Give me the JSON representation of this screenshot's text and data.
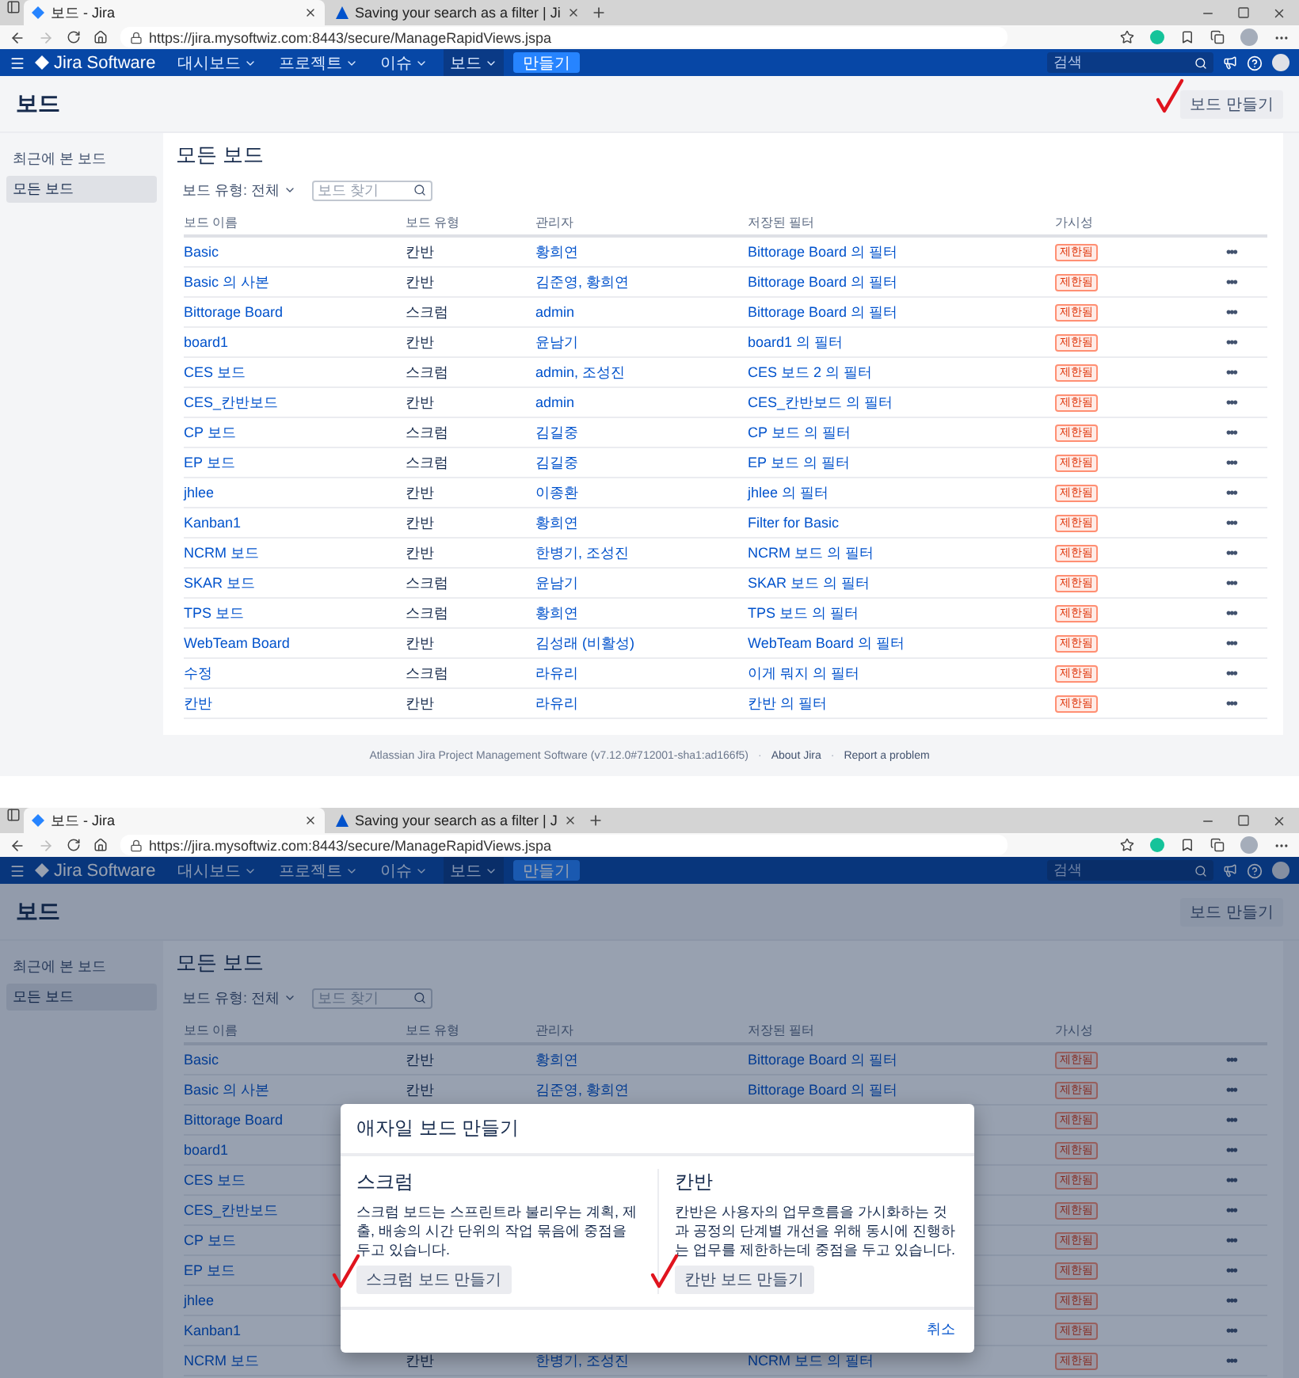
{
  "screens": [
    {
      "browser": {
        "tabs": [
          {
            "title": "보드 - Jira",
            "kind": "jira",
            "selected": true
          },
          {
            "title": "Saving your search as a filter | Ji",
            "kind": "atlassian",
            "selected": false
          }
        ],
        "url": "https://jira.mysoftwiz.com:8443/secure/ManageRapidViews.jspa"
      },
      "nav": {
        "logo": "Jira Software",
        "menus": [
          {
            "label": "대시보드",
            "selected": false
          },
          {
            "label": "프로젝트",
            "selected": false
          },
          {
            "label": "이슈",
            "selected": false
          },
          {
            "label": "보드",
            "selected": true
          }
        ],
        "create": "만들기",
        "search": {
          "placeholder": "검색"
        }
      },
      "header": {
        "title": "보드",
        "button": {
          "label": "보드 만들기",
          "annotated": true
        }
      },
      "sidebar": [
        {
          "label": "최근에 본 보드",
          "selected": false
        },
        {
          "label": "모든 보드",
          "selected": true
        }
      ],
      "content": {
        "title": "모든 보드",
        "filter": "보드 유형: 전체",
        "search": {
          "placeholder": "보드 찾기"
        }
      },
      "table": {
        "columns": [
          "보드 이름",
          "보드 유형",
          "관리자",
          "저장된 필터",
          "가시성"
        ],
        "rows": [
          {
            "name": "Basic",
            "type": "칸반",
            "admin": "황희연",
            "filter": "Bittorage Board 의 필터",
            "visibility": "제한됨",
            "more": "•••"
          },
          {
            "name": "Basic 의 사본",
            "type": "칸반",
            "admin": "김준영, 황희연",
            "filter": "Bittorage Board 의 필터",
            "visibility": "제한됨",
            "more": "•••"
          },
          {
            "name": "Bittorage Board",
            "type": "스크럼",
            "admin": "admin",
            "filter": "Bittorage Board 의 필터",
            "visibility": "제한됨",
            "more": "•••"
          },
          {
            "name": "board1",
            "type": "칸반",
            "admin": "윤남기",
            "filter": "board1 의 필터",
            "visibility": "제한됨",
            "more": "•••"
          },
          {
            "name": "CES 보드",
            "type": "스크럼",
            "admin": "admin, 조성진",
            "filter": "CES 보드 2 의 필터",
            "visibility": "제한됨",
            "more": "•••"
          },
          {
            "name": "CES_칸반보드",
            "type": "칸반",
            "admin": "admin",
            "filter": "CES_칸반보드 의 필터",
            "visibility": "제한됨",
            "more": "•••"
          },
          {
            "name": "CP 보드",
            "type": "스크럼",
            "admin": "김길중",
            "filter": "CP 보드 의 필터",
            "visibility": "제한됨",
            "more": "•••"
          },
          {
            "name": "EP 보드",
            "type": "스크럼",
            "admin": "김길중",
            "filter": "EP 보드 의 필터",
            "visibility": "제한됨",
            "more": "•••"
          },
          {
            "name": "jhlee",
            "type": "칸반",
            "admin": "이종환",
            "filter": "jhlee 의 필터",
            "visibility": "제한됨",
            "more": "•••"
          },
          {
            "name": "Kanban1",
            "type": "칸반",
            "admin": "황희연",
            "filter": "Filter for Basic",
            "visibility": "제한됨",
            "more": "•••"
          },
          {
            "name": "NCRM 보드",
            "type": "칸반",
            "admin": "한병기, 조성진",
            "filter": "NCRM 보드 의 필터",
            "visibility": "제한됨",
            "more": "•••"
          },
          {
            "name": "SKAR 보드",
            "type": "스크럼",
            "admin": "윤남기",
            "filter": "SKAR 보드 의 필터",
            "visibility": "제한됨",
            "more": "•••"
          },
          {
            "name": "TPS 보드",
            "type": "스크럼",
            "admin": "황희연",
            "filter": "TPS 보드 의 필터",
            "visibility": "제한됨",
            "more": "•••"
          },
          {
            "name": "WebTeam Board",
            "type": "칸반",
            "admin": "김성래 (비활성)",
            "filter": "WebTeam Board 의 필터",
            "visibility": "제한됨",
            "more": "•••"
          },
          {
            "name": "수정",
            "type": "스크럼",
            "admin": "라유리",
            "filter": "이게 뭐지 의 필터",
            "visibility": "제한됨",
            "more": "•••"
          },
          {
            "name": "칸반",
            "type": "칸반",
            "admin": "라유리",
            "filter": "칸반 의 필터",
            "visibility": "제한됨",
            "more": "•••"
          }
        ]
      },
      "footer": [
        {
          "text": "Atlassian Jira Project Management Software (v7.12.0#712001-sha1:ad166f5)",
          "kind": "text"
        },
        {
          "text": "·",
          "kind": "separator"
        },
        {
          "text": "About Jira",
          "kind": "link"
        },
        {
          "text": "·",
          "kind": "separator"
        },
        {
          "text": "Report a problem",
          "kind": "link"
        }
      ]
    },
    {
      "browser": {
        "tabs": [
          {
            "title": "보드 - Jira",
            "kind": "jira",
            "selected": true
          },
          {
            "title": "Saving your search as a filter | J",
            "kind": "atlassian",
            "selected": false
          }
        ],
        "url": "https://jira.mysoftwiz.com:8443/secure/ManageRapidViews.jspa"
      },
      "nav": {
        "logo": "Jira Software",
        "menus": [
          {
            "label": "대시보드",
            "selected": false
          },
          {
            "label": "프로젝트",
            "selected": false
          },
          {
            "label": "이슈",
            "selected": false
          },
          {
            "label": "보드",
            "selected": true
          }
        ],
        "create": "만들기",
        "search": {
          "placeholder": "검색"
        }
      },
      "header": {
        "title": "보드",
        "button": {
          "label": "보드 만들기"
        }
      },
      "sidebar": [
        {
          "label": "최근에 본 보드",
          "selected": false
        },
        {
          "label": "모든 보드",
          "selected": true
        }
      ],
      "content": {
        "title": "모든 보드",
        "filter": "보드 유형: 전체",
        "search": {
          "placeholder": "보드 찾기"
        }
      },
      "table": {
        "columns": [
          "보드 이름",
          "보드 유형",
          "관리자",
          "저장된 필터",
          "가시성"
        ],
        "rows": [
          {
            "name": "Basic",
            "type": "칸반",
            "admin": "황희연",
            "filter": "Bittorage Board 의 필터",
            "visibility": "제한됨",
            "more": "•••"
          },
          {
            "name": "Basic 의 사본",
            "type": "칸반",
            "admin": "김준영, 황희연",
            "filter": "Bittorage Board 의 필터",
            "visibility": "제한됨",
            "more": "•••"
          },
          {
            "name": "Bittorage Board",
            "visibility": "제한됨",
            "more": "•••"
          },
          {
            "name": "board1",
            "visibility": "제한됨",
            "more": "•••"
          },
          {
            "name": "CES 보드",
            "visibility": "제한됨",
            "more": "•••"
          },
          {
            "name": "CES_칸반보드",
            "visibility": "제한됨",
            "more": "•••"
          },
          {
            "name": "CP 보드",
            "visibility": "제한됨",
            "more": "•••"
          },
          {
            "name": "EP 보드",
            "visibility": "제한됨",
            "more": "•••"
          },
          {
            "name": "jhlee",
            "visibility": "제한됨",
            "more": "•••"
          },
          {
            "name": "Kanban1",
            "visibility": "제한됨",
            "more": "•••"
          },
          {
            "name": "NCRM 보드",
            "type": "칸반",
            "admin": "한병기, 조성진",
            "filter": "NCRM 보드 의 필터",
            "visibility": "제한됨",
            "more": "•••"
          }
        ]
      },
      "modal": {
        "title": "애자일 보드 만들기",
        "options": [
          {
            "heading": "스크럼",
            "description": "스크럼 보드는 스프린트라 불리우는 계획, 제출, 배송의 시간 단위의 작업 묶음에 중점을 두고 있습니다.",
            "button": {
              "label": "스크럼 보드 만들기",
              "annotated": true
            }
          },
          {
            "heading": "칸반",
            "description": "칸반은 사용자의 업무흐름을 가시화하는 것과 공정의 단계별 개선을 위해 동시에 진행하는 업무를 제한하는데 중점을 두고 있습니다.",
            "button": {
              "label": "칸반 보드 만들기",
              "annotated": true
            }
          }
        ],
        "cancel": "취소"
      }
    }
  ]
}
